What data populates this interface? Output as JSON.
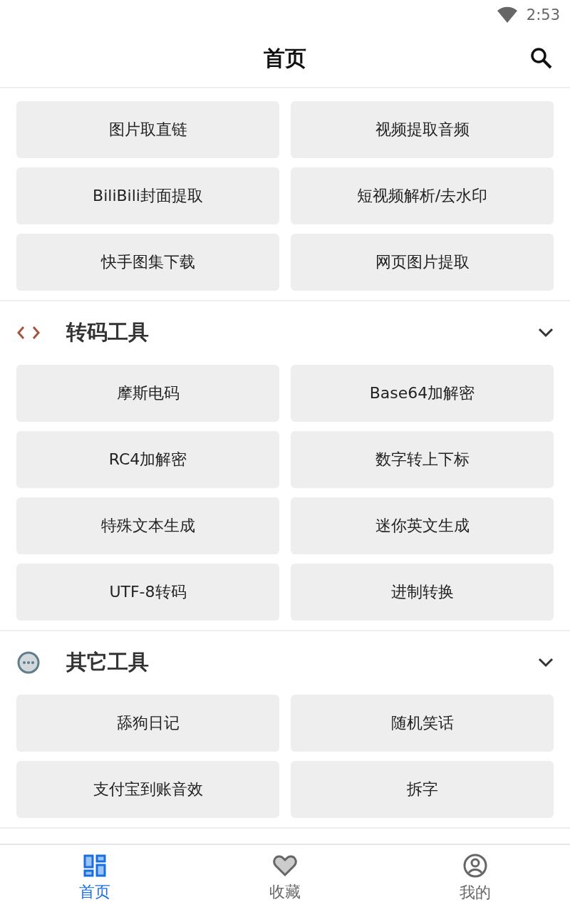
{
  "status_bar": {
    "time": "2:53"
  },
  "app_bar": {
    "title": "首页"
  },
  "sections": [
    {
      "items": [
        "图片取直链",
        "视频提取音频",
        "BiliBili封面提取",
        "短视频解析/去水印",
        "快手图集下载",
        "网页图片提取"
      ]
    },
    {
      "title": "转码工具",
      "expanded": true,
      "items": [
        "摩斯电码",
        "Base64加解密",
        "RC4加解密",
        "数字转上下标",
        "特殊文本生成",
        "迷你英文生成",
        "UTF-8转码",
        "进制转换"
      ]
    },
    {
      "title": "其它工具",
      "expanded": true,
      "items": [
        "舔狗日记",
        "随机笑话",
        "支付宝到账音效",
        "拆字"
      ]
    }
  ],
  "bottom_nav": [
    {
      "label": "首页",
      "selected": true
    },
    {
      "label": "收藏",
      "selected": false
    },
    {
      "label": "我的",
      "selected": false
    }
  ]
}
